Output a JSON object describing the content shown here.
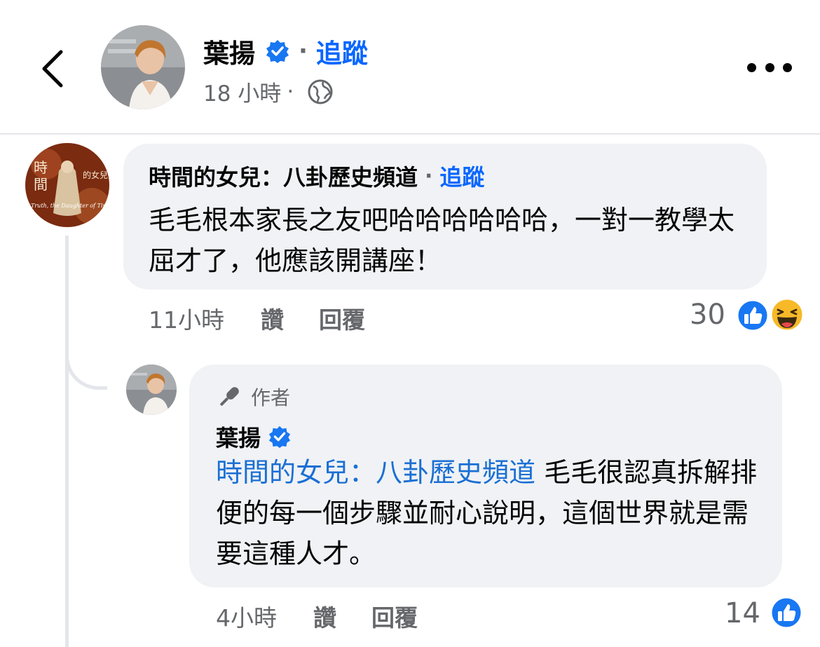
{
  "header": {
    "author_name": "葉揚",
    "separator": "·",
    "follow_label": "追蹤",
    "time": "18 小時",
    "meta_separator": "·",
    "privacy_icon": "globe-icon",
    "more_icon": "more-options-icon",
    "back_icon": "chevron-left-icon"
  },
  "comment": {
    "author_name": "時間的女兒：八卦歷史頻道",
    "separator": "·",
    "follow_label": "追蹤",
    "avatar_text_top": "時",
    "avatar_text_mid": "間",
    "avatar_text_right": "的女兒",
    "avatar_text_caption": "Truth, the Daughter of Time.",
    "text": "毛毛根本家長之友吧哈哈哈哈哈哈，一對一教學太屈才了，他應該開講座！",
    "time": "11小時",
    "like_label": "讚",
    "reply_label": "回覆",
    "reaction_count": "30",
    "reactions": [
      "like-reaction-icon",
      "haha-reaction-icon"
    ]
  },
  "reply": {
    "badge_label": "作者",
    "badge_icon": "author-microphone-icon",
    "author_name": "葉揚",
    "mention": "時間的女兒：八卦歷史頻道",
    "text": " 毛毛很認真拆解排便的每一個步驟並耐心說明，這個世界就是需要這種人才。",
    "time": "4小時",
    "like_label": "讚",
    "reply_label": "回覆",
    "reaction_count": "14",
    "reactions": [
      "like-reaction-icon"
    ]
  },
  "colors": {
    "accent_blue": "#0866ff",
    "mention_blue": "#1a6fd4",
    "bubble_bg": "#f0f2f5",
    "secondary_text": "#65676b",
    "verified_blue": "#1877f2",
    "haha_yellow": "#f7b928"
  }
}
